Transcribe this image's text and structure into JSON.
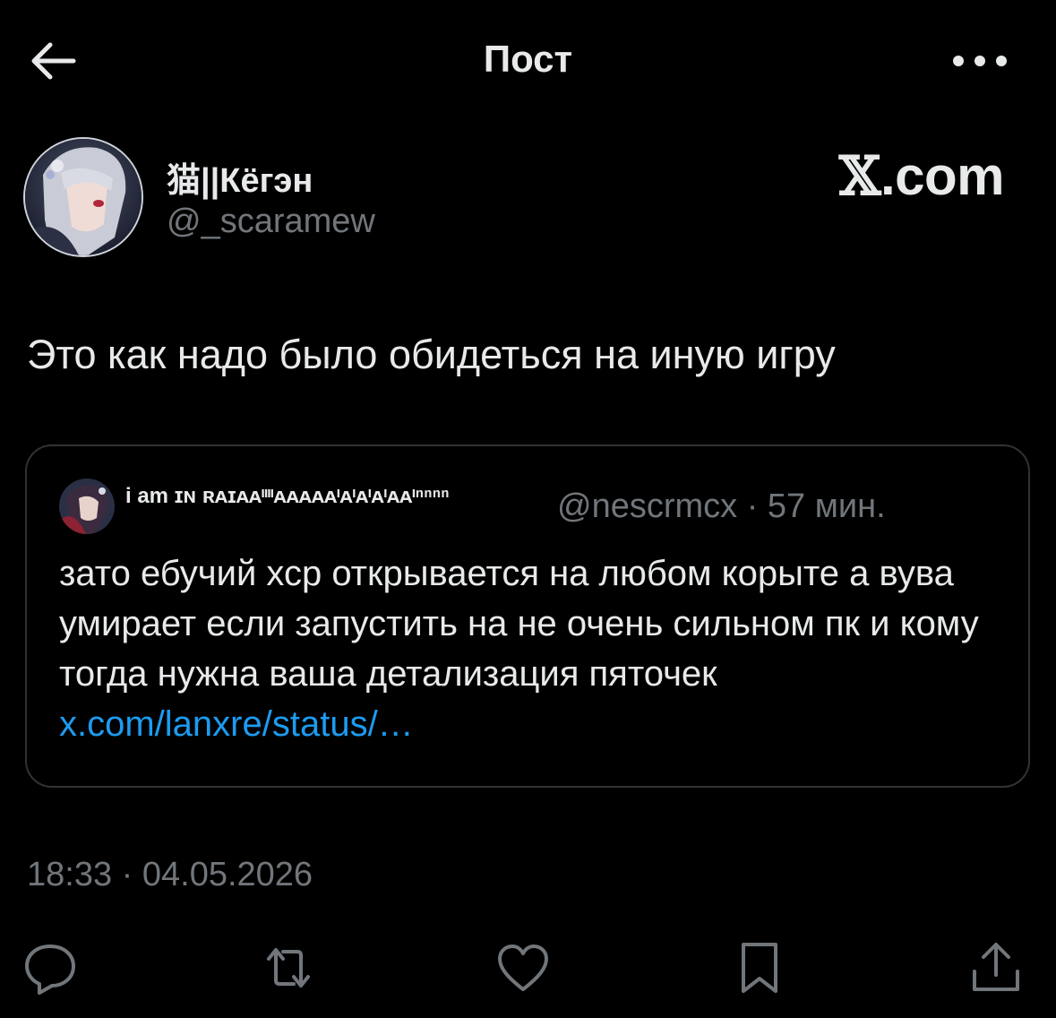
{
  "header": {
    "title": "Пост",
    "back_icon": "arrow-left-icon",
    "more_icon": "more-horizontal-icon"
  },
  "author": {
    "display_name": "猫||Кёгэн",
    "handle": "@_scaramew",
    "avatar_icon": "anime-avatar"
  },
  "brand": {
    "x": "𝕏",
    "domain": ".com"
  },
  "post": {
    "text": "Это как надо было обидеться на иную игру",
    "timestamp": "18:33 · 04.05.2026"
  },
  "quoted": {
    "name": "i am ɪɴ ʀᴀɪᴀᴀᶦᶦᶦᶦᴀᴀᴀᴀᴀᶦᴀᶦᴀᶦᴀᶦᴀᴀᶦⁿⁿⁿⁿ",
    "meta": "@nescrmcx · 57 мин.",
    "text": "зато ебучий хср открывается на любом корыте а вува умирает если запустить на не очень сильном пк и кому тогда нужна ваша детализация пяточек ",
    "link": "x.com/lanxre/status/…",
    "avatar_icon": "anime-avatar-small"
  },
  "actions": [
    {
      "name": "reply",
      "icon": "reply-icon"
    },
    {
      "name": "repost",
      "icon": "repost-icon"
    },
    {
      "name": "like",
      "icon": "heart-icon"
    },
    {
      "name": "bookmark",
      "icon": "bookmark-icon"
    },
    {
      "name": "share",
      "icon": "share-icon"
    }
  ],
  "colors": {
    "background": "#000000",
    "text": "#e7e9ea",
    "muted": "#71767b",
    "link": "#1d9bf0",
    "border": "#2f3336"
  }
}
